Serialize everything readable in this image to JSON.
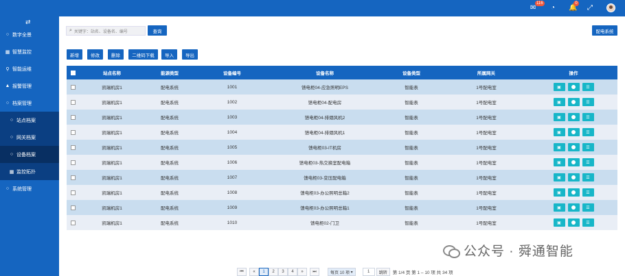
{
  "topbar": {
    "mail_badge": "116",
    "bell_badge": "0"
  },
  "sidebar": {
    "items": [
      {
        "label": "数字全景",
        "icon": "circle-icon"
      },
      {
        "label": "智慧监控",
        "icon": "grid-icon"
      },
      {
        "label": "智能运维",
        "icon": "sitemap-icon"
      },
      {
        "label": "报警管理",
        "icon": "bell-icon"
      },
      {
        "label": "档案管理",
        "icon": "circle-icon"
      }
    ],
    "sub_items": [
      {
        "label": "站点档案"
      },
      {
        "label": "网关档案"
      },
      {
        "label": "设备档案"
      },
      {
        "label": "监控拓扑"
      }
    ],
    "last_item": {
      "label": "系统管理"
    }
  },
  "search": {
    "placeholder": "关键字：站名、设备名、编号",
    "button": "查询",
    "right_button": "配电系统"
  },
  "toolbar": [
    "新增",
    "修改",
    "删除",
    "二维码下载",
    "导入",
    "导出"
  ],
  "table": {
    "headers": [
      "站点名称",
      "能源类型",
      "设备编号",
      "设备名称",
      "设备类型",
      "所属网关",
      "操作"
    ],
    "rows": [
      [
        "凯瑞机房1",
        "配电系统",
        "1001",
        "馈电柜04-应急照明EPS",
        "智能表",
        "1号配电室"
      ],
      [
        "凯瑞机房1",
        "配电系统",
        "1002",
        "馈电柜04-配电房",
        "智能表",
        "1号配电室"
      ],
      [
        "凯瑞机房1",
        "配电系统",
        "1003",
        "馈电柜04-排烟风机2",
        "智能表",
        "1号配电室"
      ],
      [
        "凯瑞机房1",
        "配电系统",
        "1004",
        "馈电柜04-排烟风机1",
        "智能表",
        "1号配电室"
      ],
      [
        "凯瑞机房1",
        "配电系统",
        "1005",
        "馈电柜03-IT机房",
        "智能表",
        "1号配电室"
      ],
      [
        "凯瑞机房1",
        "配电系统",
        "1006",
        "馈电柜03-热交换室配电箱",
        "智能表",
        "1号配电室"
      ],
      [
        "凯瑞机房1",
        "配电系统",
        "1007",
        "馈电柜03-变压配电箱",
        "智能表",
        "1号配电室"
      ],
      [
        "凯瑞机房1",
        "配电系统",
        "1008",
        "馈电柜03-办公照明总箱2",
        "智能表",
        "1号配电室"
      ],
      [
        "凯瑞机房1",
        "配电系统",
        "1009",
        "馈电柜03-办公照明总箱1",
        "智能表",
        "1号配电室"
      ],
      [
        "凯瑞机房1",
        "配电系统",
        "1010",
        "馈电柜02-门卫",
        "智能表",
        "1号配电室"
      ]
    ]
  },
  "pager": {
    "first": "⏮",
    "prev": "«",
    "pages": [
      "1",
      "2",
      "3",
      "4"
    ],
    "next": "»",
    "last": "⏭",
    "page_size": "每页 10 项",
    "goto_value": "1",
    "goto_button": "跳转",
    "summary": "第 1/4 页  第 1 – 10 项  共 34 项"
  },
  "watermark": "公众号 · 舜通智能"
}
